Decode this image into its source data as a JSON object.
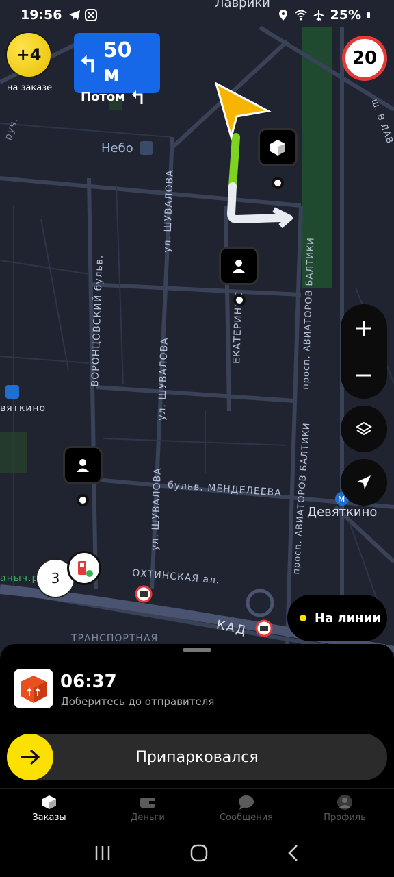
{
  "status_bar": {
    "time": "19:56",
    "battery": "25%",
    "icons": [
      "telegram-icon",
      "app-icon",
      "location-icon",
      "wifi-icon",
      "airplane-icon",
      "battery-icon"
    ]
  },
  "map": {
    "bonus": {
      "value": "+4",
      "caption": "на заказе"
    },
    "maneuver": {
      "distance": "50 м",
      "next_label": "Потом",
      "icon": "turn-left-icon"
    },
    "speed_limit": "20",
    "labels": {
      "lavriki": "Лаврики",
      "nebo": "Небо",
      "shuvalova_1": "ул. ШУВАЛОВА",
      "shuvalova_2": "ул. ШУВАЛОВА",
      "shuvalova_3": "ул. ШУВАЛОВА",
      "vorontsovsky": "ВОРОНЦОВСКИЙ бульв.",
      "ekaterinoslavskaya": "ЕКАТЕРИНОС",
      "aviatorov_1": "просп. АВИАТОРОВ БАЛТИКИ",
      "aviatorov_2": "просп. АВИАТОРОВ БАЛТИКИ",
      "aviatorov_3": "просп. АВИАТОРОВ БАЛТИКИ",
      "mendeleeva": "бульв. МЕНДЕЛЕЕВА",
      "okhtinskaya": "ОХТИНСКАЯ ал.",
      "kad": "КАД",
      "transportnaya": "ТРАНСПОРТНАЯ",
      "devyatkino_left": "вяткино",
      "devyatkino": "Девяткино",
      "vlav": "ш. В ЛАВ",
      "ruch": "руч.",
      "anych": "аныч.р"
    },
    "cluster_count": "3",
    "online_label": "На линии",
    "accent": "#fce000",
    "route_color": "#7ed321"
  },
  "order": {
    "eta": "06:37",
    "subtitle": "Доберитесь до отправителя",
    "action_label": "Припарковался"
  },
  "tabs": [
    {
      "label": "Заказы",
      "icon": "orders-icon",
      "active": true
    },
    {
      "label": "Деньги",
      "icon": "wallet-icon",
      "active": false
    },
    {
      "label": "Сообщения",
      "icon": "chat-icon",
      "active": false
    },
    {
      "label": "Профиль",
      "icon": "avatar-icon",
      "active": false
    }
  ]
}
